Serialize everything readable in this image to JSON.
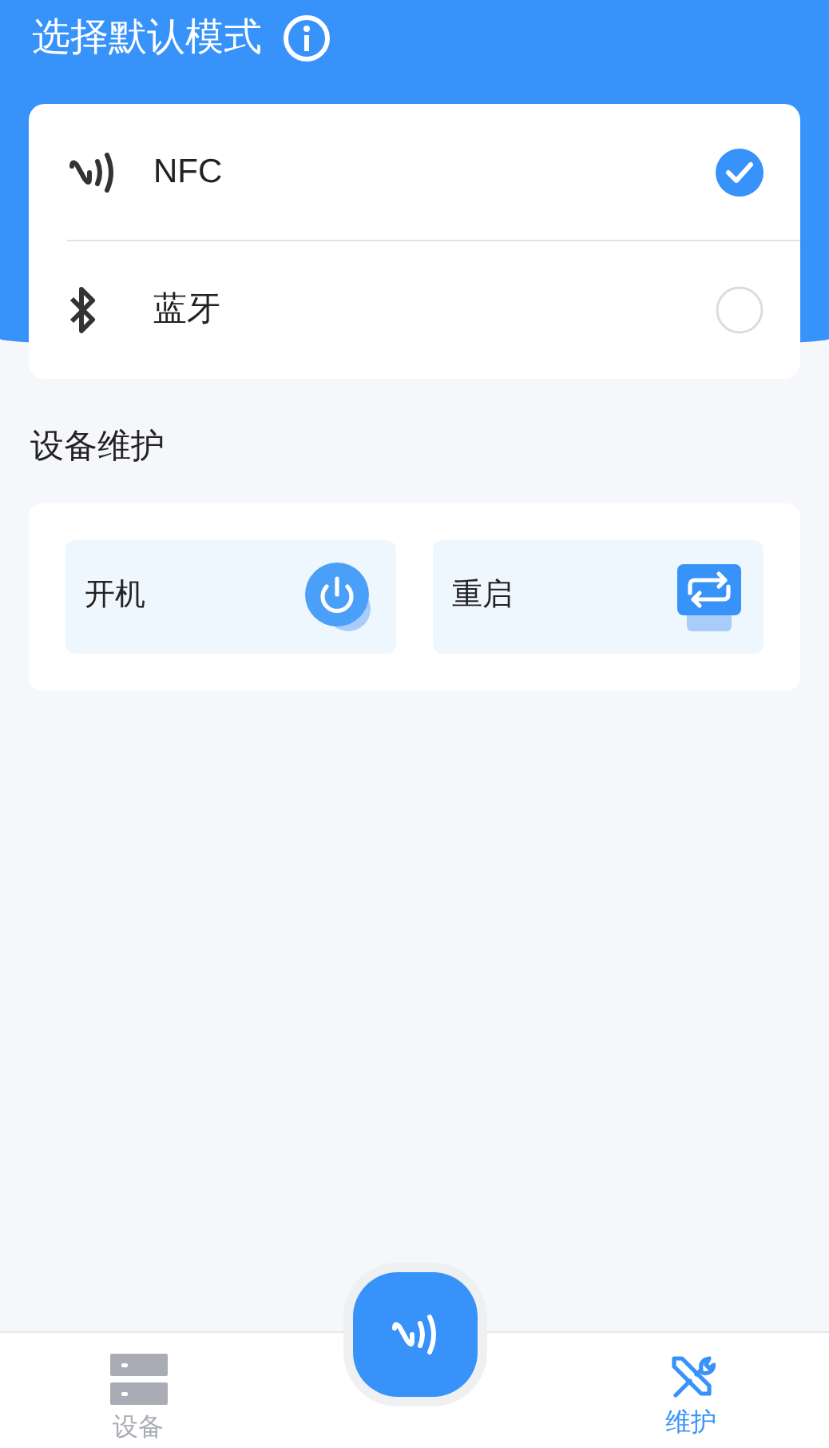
{
  "header": {
    "title": "选择默认模式"
  },
  "modes": [
    {
      "kind": "nfc",
      "label": "NFC",
      "selected": true
    },
    {
      "kind": "bluetooth",
      "label": "蓝牙",
      "selected": false
    }
  ],
  "maintenance": {
    "title": "设备维护",
    "actions": [
      {
        "kind": "power",
        "label": "开机"
      },
      {
        "kind": "restart",
        "label": "重启"
      }
    ]
  },
  "tab_bar": [
    {
      "kind": "devices",
      "label": "设备",
      "selected": false
    },
    {
      "kind": "nfc",
      "selected": false
    },
    {
      "kind": "maintenance",
      "label": "维护",
      "selected": true
    }
  ]
}
